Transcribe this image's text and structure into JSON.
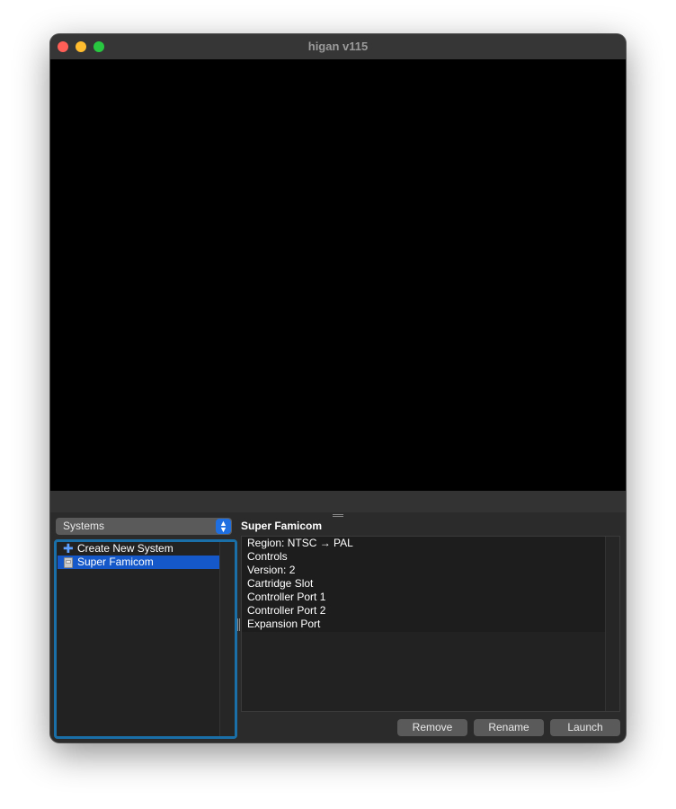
{
  "window": {
    "title": "higan v115"
  },
  "sidebar": {
    "selector_value": "Systems",
    "items": [
      {
        "label": "Create New System",
        "icon": "plus-icon"
      },
      {
        "label": "Super Famicom",
        "icon": "cartridge-icon",
        "selected": true
      }
    ]
  },
  "details": {
    "title": "Super Famicom",
    "rows": [
      "Region: NTSC → PAL",
      "Controls",
      "Version: 2",
      "Cartridge Slot",
      "Controller Port 1",
      "Controller Port 2",
      "Expansion Port"
    ]
  },
  "actions": {
    "remove_label": "Remove",
    "rename_label": "Rename",
    "launch_label": "Launch"
  },
  "colors": {
    "selection": "#1458c9",
    "focus_ring": "#1a6fa8",
    "select_accent": "#1f6fe0",
    "close": "#ff5f57",
    "minimize": "#febc2e",
    "zoom": "#28c840"
  }
}
